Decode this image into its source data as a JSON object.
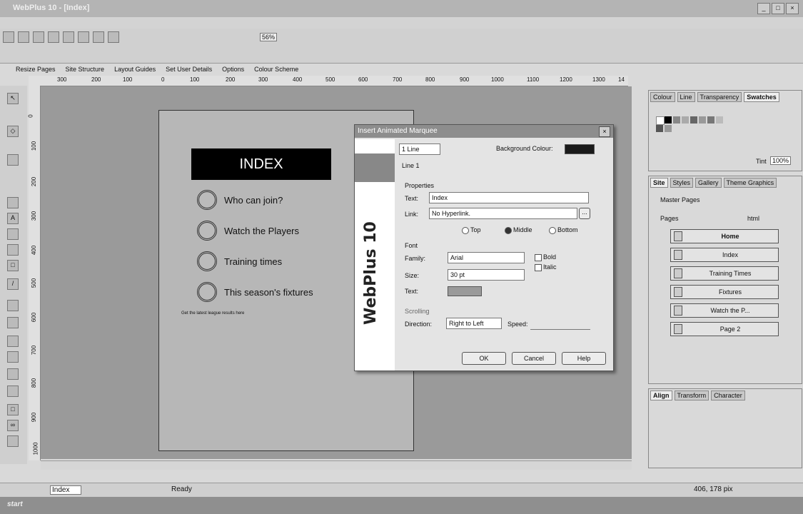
{
  "window": {
    "title": "WebPlus 10 - [Index]"
  },
  "toolbar2": {
    "items": [
      "Resize Pages",
      "Site Structure",
      "Layout Guides",
      "Set User Details",
      "Options",
      "Colour Scheme"
    ],
    "zoom": "56%"
  },
  "ruler": {
    "h_ticks": [
      "300",
      "200",
      "100",
      "0",
      "100",
      "200",
      "300",
      "400",
      "500",
      "600",
      "700",
      "800",
      "900",
      "1000",
      "1100",
      "1200",
      "1300",
      "14"
    ],
    "v_ticks": [
      "0",
      "100",
      "200",
      "300",
      "400",
      "500",
      "600",
      "700",
      "800",
      "900",
      "1000"
    ]
  },
  "page": {
    "heading": "INDEX",
    "menu": [
      "Who can join?",
      "Watch the Players",
      "Training times",
      "This season's fixtures"
    ],
    "marquee_text": "Get the latest league results here"
  },
  "dialog": {
    "title": "Insert Animated Marquee",
    "lines_select": "1 Line",
    "background_label": "Background Colour:",
    "line_tab": "Line 1",
    "brand": "WebPlus 10",
    "properties_label": "Properties",
    "text_label": "Text:",
    "text_value": "Index",
    "link_label": "Link:",
    "link_value": "No Hyperlink.",
    "link_browse": "...",
    "pos_top": "Top",
    "pos_middle": "Middle",
    "pos_bottom": "Bottom",
    "font_label": "Font",
    "family_label": "Family:",
    "family_value": "Arial",
    "bold_label": "Bold",
    "italic_label": "Italic",
    "size_label": "Size:",
    "size_value": "30 pt",
    "text_colour_label": "Text:",
    "scrolling_label": "Scrolling",
    "direction_label": "Direction:",
    "direction_value": "Right to Left",
    "speed_label": "Speed:",
    "ok": "OK",
    "cancel": "Cancel",
    "help": "Help",
    "bg_color": "#1a1a1a",
    "text_color": "#9a9a9a"
  },
  "swatch_panel": {
    "tabs": [
      "Colour",
      "Line",
      "Transparency",
      "Swatches"
    ],
    "active": "Swatches",
    "tint_label": "Tint",
    "tint_value": "100%"
  },
  "site_panel": {
    "tabs": [
      "Site",
      "Styles",
      "Gallery",
      "Theme Graphics"
    ],
    "master_pages": "Master Pages",
    "pages_label": "Pages",
    "html_label": "html",
    "pages": [
      "Home",
      "Index",
      "Training Times",
      "Fixtures",
      "Watch the P...",
      "Page 2"
    ]
  },
  "align_panel": {
    "tabs": [
      "Align",
      "Transform",
      "Character"
    ]
  },
  "status": {
    "page_select": "Index",
    "ready": "Ready",
    "coords": "406, 178 pix"
  },
  "taskbar": {
    "start": "start"
  }
}
